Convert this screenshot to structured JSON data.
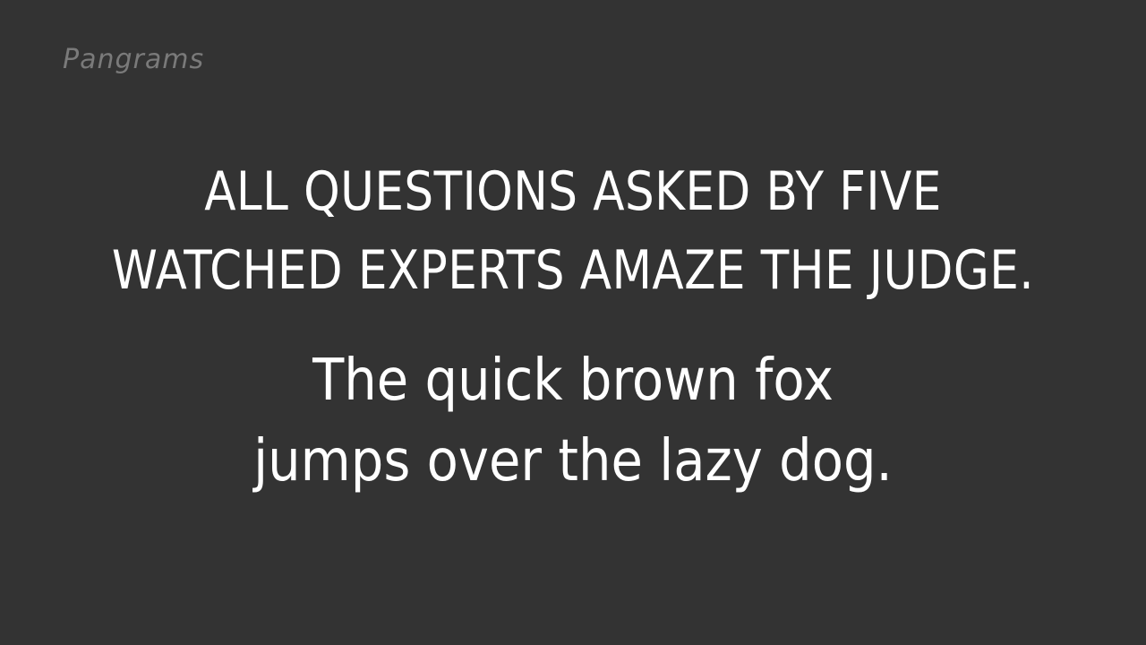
{
  "label": "Pangrams",
  "pangrams": [
    {
      "lines": [
        "ALL QUESTIONS ASKED BY FIVE",
        "WATCHED EXPERTS AMAZE THE JUDGE."
      ]
    },
    {
      "lines": [
        "The quick brown fox",
        "jumps over the lazy dog."
      ]
    }
  ],
  "colors": {
    "background": "#333333",
    "text": "#ffffff",
    "label": "#7a7a7a"
  }
}
